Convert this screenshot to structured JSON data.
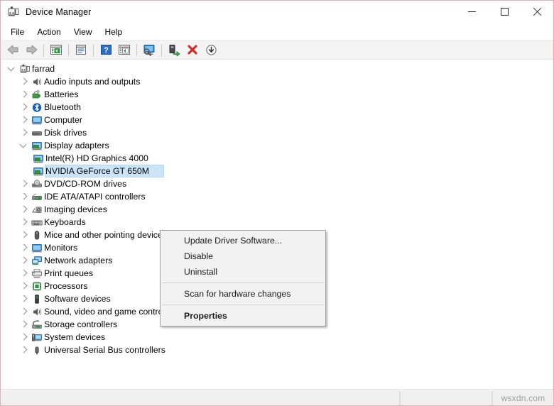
{
  "window": {
    "title": "Device Manager",
    "icon": "device-manager-icon",
    "caption_buttons": [
      {
        "name": "minimize-button",
        "glyph": "minimize"
      },
      {
        "name": "maximize-button",
        "glyph": "maximize"
      },
      {
        "name": "close-button",
        "glyph": "close"
      }
    ]
  },
  "menubar": {
    "items": [
      {
        "label": "File"
      },
      {
        "label": "Action"
      },
      {
        "label": "View"
      },
      {
        "label": "Help"
      }
    ]
  },
  "toolbar": {
    "buttons": [
      {
        "name": "back-button",
        "icon": "back-arrow-icon"
      },
      {
        "name": "forward-button",
        "icon": "forward-arrow-icon"
      },
      {
        "name": "show-hide-console-tree-button",
        "icon": "console-tree-icon"
      },
      {
        "name": "properties-button",
        "icon": "properties-window-icon"
      },
      {
        "name": "help-button",
        "icon": "help-question-icon"
      },
      {
        "name": "update-driver-button",
        "icon": "update-driver-icon"
      },
      {
        "name": "scan-hardware-changes-button",
        "icon": "scan-monitor-icon"
      },
      {
        "name": "enable-device-button",
        "icon": "enable-device-icon"
      },
      {
        "name": "uninstall-device-button",
        "icon": "uninstall-red-x-icon"
      },
      {
        "name": "add-legacy-hardware-button",
        "icon": "download-circle-icon"
      }
    ]
  },
  "tree": {
    "items": [
      {
        "label": "farrad",
        "depth": 0,
        "state": "expanded",
        "icon": "computer-root-icon",
        "selected": false
      },
      {
        "label": "Audio inputs and outputs",
        "depth": 1,
        "state": "collapsed",
        "icon": "speaker-icon",
        "selected": false
      },
      {
        "label": "Batteries",
        "depth": 1,
        "state": "collapsed",
        "icon": "battery-icon",
        "selected": false
      },
      {
        "label": "Bluetooth",
        "depth": 1,
        "state": "collapsed",
        "icon": "bluetooth-icon",
        "selected": false
      },
      {
        "label": "Computer",
        "depth": 1,
        "state": "collapsed",
        "icon": "monitor-icon",
        "selected": false
      },
      {
        "label": "Disk drives",
        "depth": 1,
        "state": "collapsed",
        "icon": "disk-drive-icon",
        "selected": false
      },
      {
        "label": "Display adapters",
        "depth": 1,
        "state": "expanded",
        "icon": "display-adapter-icon",
        "selected": false
      },
      {
        "label": "Intel(R) HD Graphics 4000",
        "depth": 2,
        "state": "leaf",
        "icon": "display-adapter-icon",
        "selected": false
      },
      {
        "label": "NVIDIA GeForce GT 650M",
        "depth": 2,
        "state": "leaf",
        "icon": "display-adapter-icon",
        "selected": true
      },
      {
        "label": "DVD/CD-ROM drives",
        "depth": 1,
        "state": "collapsed",
        "icon": "optical-drive-icon",
        "selected": false
      },
      {
        "label": "IDE ATA/ATAPI controllers",
        "depth": 1,
        "state": "collapsed",
        "icon": "ide-controller-icon",
        "selected": false
      },
      {
        "label": "Imaging devices",
        "depth": 1,
        "state": "collapsed",
        "icon": "imaging-device-icon",
        "selected": false
      },
      {
        "label": "Keyboards",
        "depth": 1,
        "state": "collapsed",
        "icon": "keyboard-icon",
        "selected": false
      },
      {
        "label": "Mice and other pointing devices",
        "depth": 1,
        "state": "collapsed",
        "icon": "mouse-icon",
        "selected": false
      },
      {
        "label": "Monitors",
        "depth": 1,
        "state": "collapsed",
        "icon": "monitor-icon",
        "selected": false
      },
      {
        "label": "Network adapters",
        "depth": 1,
        "state": "collapsed",
        "icon": "network-adapter-icon",
        "selected": false
      },
      {
        "label": "Print queues",
        "depth": 1,
        "state": "collapsed",
        "icon": "printer-icon",
        "selected": false
      },
      {
        "label": "Processors",
        "depth": 1,
        "state": "collapsed",
        "icon": "processor-icon",
        "selected": false
      },
      {
        "label": "Software devices",
        "depth": 1,
        "state": "collapsed",
        "icon": "software-device-icon",
        "selected": false
      },
      {
        "label": "Sound, video and game controllers",
        "depth": 1,
        "state": "collapsed",
        "icon": "speaker-icon",
        "selected": false
      },
      {
        "label": "Storage controllers",
        "depth": 1,
        "state": "collapsed",
        "icon": "storage-controller-icon",
        "selected": false
      },
      {
        "label": "System devices",
        "depth": 1,
        "state": "collapsed",
        "icon": "system-device-icon",
        "selected": false
      },
      {
        "label": "Universal Serial Bus controllers",
        "depth": 1,
        "state": "collapsed",
        "icon": "usb-icon",
        "selected": false
      }
    ]
  },
  "context_menu": {
    "items": [
      {
        "label": "Update Driver Software...",
        "type": "item",
        "bold": false
      },
      {
        "label": "Disable",
        "type": "item",
        "bold": false
      },
      {
        "label": "Uninstall",
        "type": "item",
        "bold": false
      },
      {
        "type": "separator"
      },
      {
        "label": "Scan for hardware changes",
        "type": "item",
        "bold": false
      },
      {
        "type": "separator"
      },
      {
        "label": "Properties",
        "type": "item",
        "bold": true
      }
    ]
  },
  "statusbar": {
    "pane1": "",
    "pane2": "",
    "watermark": "wsxdn.com"
  },
  "colors": {
    "selection": "#cce4f7",
    "selection_border": "#b0d6f1",
    "window_border": "#d8b2b8",
    "toolbar_bg": "#f3f3f3",
    "menu_bg": "#f2f2f2",
    "status_bg": "#f0f0f0"
  }
}
